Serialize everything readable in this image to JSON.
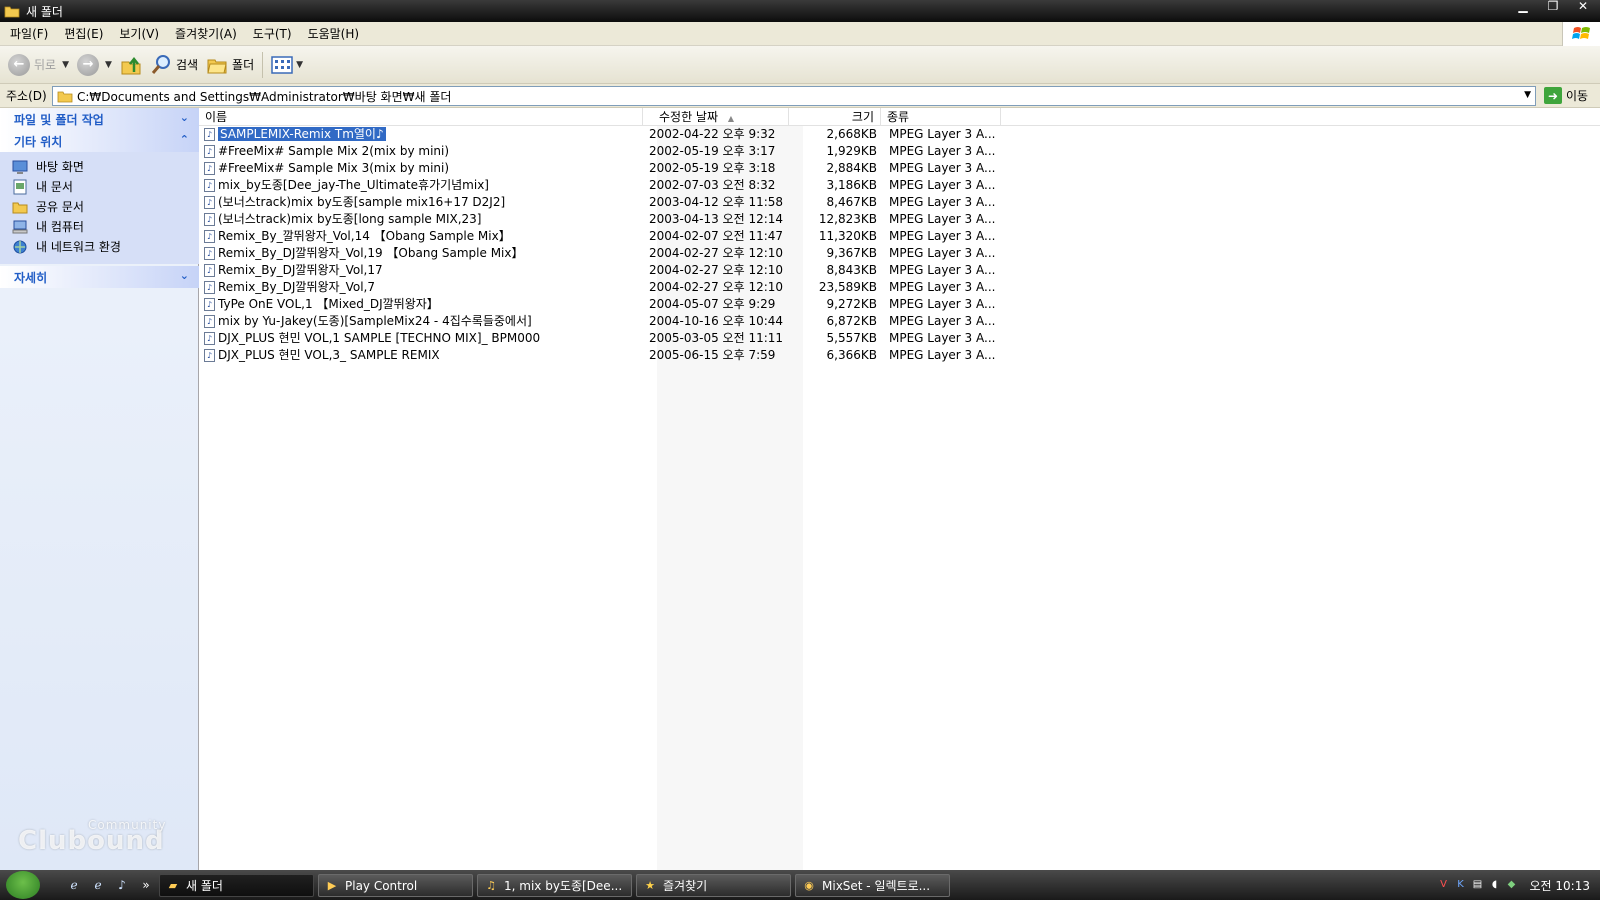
{
  "window": {
    "title": "새 폴더"
  },
  "menu": {
    "items": [
      "파일(F)",
      "편집(E)",
      "보기(V)",
      "즐겨찾기(A)",
      "도구(T)",
      "도움말(H)"
    ]
  },
  "toolbar": {
    "back_label": "뒤로",
    "search_label": "검색",
    "folders_label": "폴더"
  },
  "address": {
    "label": "주소(D)",
    "path": "C:₩Documents and Settings₩Administrator₩바탕 화면₩새 폴더",
    "go_label": "이동"
  },
  "sidebar": {
    "file_tasks_title": "파일 및 폴더 작업",
    "other_places_title": "기타 위치",
    "details_title": "자세히",
    "places": [
      {
        "label": "바탕 화면",
        "icon": "desktop-icon"
      },
      {
        "label": "내 문서",
        "icon": "my-documents-icon"
      },
      {
        "label": "공유 문서",
        "icon": "shared-folder-icon"
      },
      {
        "label": "내 컴퓨터",
        "icon": "my-computer-icon"
      },
      {
        "label": "내 네트워크 환경",
        "icon": "network-icon"
      }
    ]
  },
  "columns": {
    "name": "이름",
    "modified": "수정한 날짜",
    "size": "크기",
    "type": "종류"
  },
  "files": [
    {
      "name": "SAMPLEMIX-Remix Tm열이♪",
      "modified": "2002-04-22 오후 9:32",
      "size": "2,668KB",
      "type": "MPEG Layer 3 A...",
      "selected": true
    },
    {
      "name": "#FreeMix# Sample Mix 2(mix by mini)",
      "modified": "2002-05-19 오후 3:17",
      "size": "1,929KB",
      "type": "MPEG Layer 3 A..."
    },
    {
      "name": "#FreeMix# Sample Mix 3(mix by mini)",
      "modified": "2002-05-19 오후 3:18",
      "size": "2,884KB",
      "type": "MPEG Layer 3 A..."
    },
    {
      "name": "mix_by도종[Dee_jay-The_Ultimate휴가기념mix]",
      "modified": "2002-07-03 오전 8:32",
      "size": "3,186KB",
      "type": "MPEG Layer 3 A..."
    },
    {
      "name": "(보너스track)mix by도종[sample mix16+17 D2J2]",
      "modified": "2003-04-12 오후 11:58",
      "size": "8,467KB",
      "type": "MPEG Layer 3 A..."
    },
    {
      "name": "(보너스track)mix by도종[long sample MIX,23]",
      "modified": "2003-04-13 오전 12:14",
      "size": "12,823KB",
      "type": "MPEG Layer 3 A..."
    },
    {
      "name": "Remix_By_깔뛰왕자_Vol,14 【Obang Sample Mix】",
      "modified": "2004-02-07 오전 11:47",
      "size": "11,320KB",
      "type": "MPEG Layer 3 A..."
    },
    {
      "name": "Remix_By_DJ깔뛰왕자_Vol,19 【Obang Sample Mix】",
      "modified": "2004-02-27 오후 12:10",
      "size": "9,367KB",
      "type": "MPEG Layer 3 A..."
    },
    {
      "name": "Remix_By_DJ깔뛰왕자_Vol,17",
      "modified": "2004-02-27 오후 12:10",
      "size": "8,843KB",
      "type": "MPEG Layer 3 A..."
    },
    {
      "name": "Remix_By_DJ깔뛰왕자_Vol,7",
      "modified": "2004-02-27 오후 12:10",
      "size": "23,589KB",
      "type": "MPEG Layer 3 A..."
    },
    {
      "name": "TyPe OnE VOL,1 【Mixed_DJ깔뛰왕자】",
      "modified": "2004-05-07 오후 9:29",
      "size": "9,272KB",
      "type": "MPEG Layer 3 A..."
    },
    {
      "name": "mix by Yu-Jakey(도종)[SampleMix24 - 4집수록들중에서]",
      "modified": "2004-10-16 오후 10:44",
      "size": "6,872KB",
      "type": "MPEG Layer 3 A..."
    },
    {
      "name": "DJX_PLUS  현민 VOL,1 SAMPLE [TECHNO MIX]_ BPM000",
      "modified": "2005-03-05 오전 11:11",
      "size": "5,557KB",
      "type": "MPEG Layer 3 A..."
    },
    {
      "name": "DJX_PLUS 현민 VOL,3_ SAMPLE REMIX",
      "modified": "2005-06-15 오후 7:59",
      "size": "6,366KB",
      "type": "MPEG Layer 3 A..."
    }
  ],
  "taskbar": {
    "tasks": [
      {
        "label": "새 폴더",
        "icon": "folder-icon",
        "active": true
      },
      {
        "label": "Play Control",
        "icon": "player-icon"
      },
      {
        "label": "1, mix by도종[Dee...",
        "icon": "audio-icon"
      },
      {
        "label": "즐겨찾기",
        "icon": "star-icon"
      },
      {
        "label": "MixSet - 일렉트로...",
        "icon": "browser-icon"
      }
    ],
    "clock": "오전 10:13"
  },
  "watermark": {
    "text": "Clubound",
    "sub": "Community"
  },
  "colors": {
    "selection": "#316ac5",
    "sidebar_header_text": "#215dc6"
  }
}
